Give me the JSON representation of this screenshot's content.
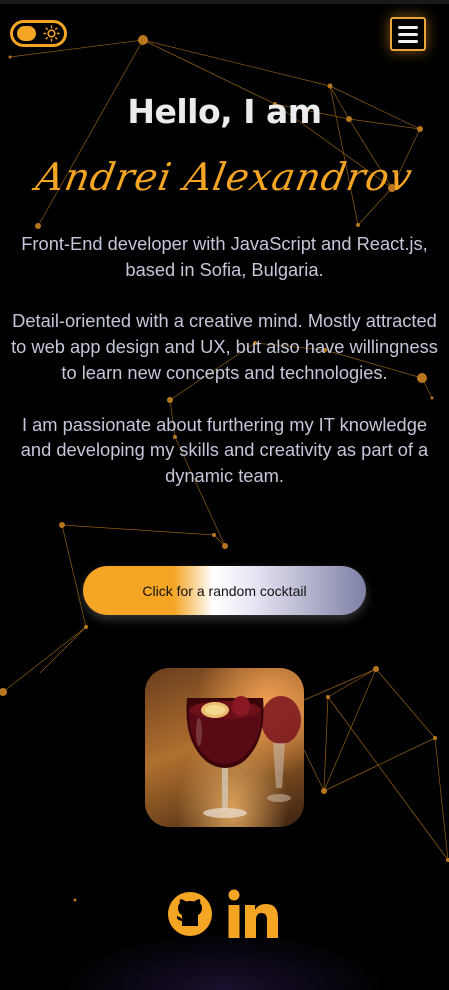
{
  "header": {
    "theme_toggle": {
      "mode": "dark",
      "icon": "sun-icon"
    },
    "menu": {
      "icon": "hamburger-icon"
    }
  },
  "hero": {
    "greeting": "Hello, I am",
    "name": "Andrei Alexandrov"
  },
  "bio": {
    "paragraph_1": "Front-End developer with JavaScript and React.js, based in Sofia, Bulgaria.",
    "paragraph_2": "Detail-oriented with a creative mind. Mostly attracted to web app design and UX, but also have willingness to learn new concepts and technologies.",
    "paragraph_3": "I am passionate about furthering my IT knowledge and developing my skills and creativity as part of a dynamic team."
  },
  "cta": {
    "label": "Click for a random cocktail"
  },
  "cocktail": {
    "image": "red-wine-sangria-glass"
  },
  "social": {
    "github_icon": "github-icon",
    "linkedin_icon": "linkedin-icon"
  },
  "colors": {
    "background": "#000000",
    "accent": "#f5a524",
    "text": "#c4c6da",
    "heading": "#ececec"
  }
}
